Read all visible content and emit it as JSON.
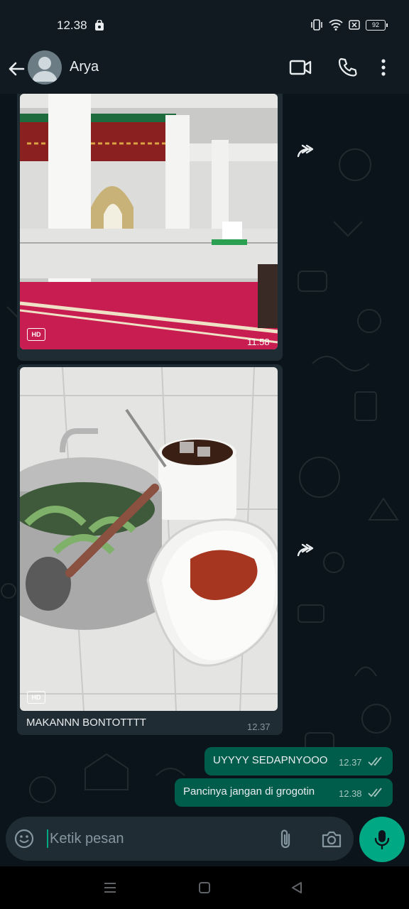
{
  "status_bar": {
    "time": "12.38",
    "battery": "92"
  },
  "header": {
    "contact_name": "Arya"
  },
  "messages": {
    "image1": {
      "time": "11.58",
      "hd_label": "HD"
    },
    "image2": {
      "time": "12.37",
      "hd_label": "HD",
      "caption": "MAKANNN BONTOTTTT"
    },
    "out1": {
      "text": "UYYYY SEDAPNYOOO",
      "time": "12.37"
    },
    "out2": {
      "text": "Pancinya jangan di grogotin",
      "time": "12.38"
    }
  },
  "input": {
    "placeholder": "Ketik pesan"
  },
  "colors": {
    "accent": "#00a884",
    "outgoing_bubble": "#005c4b",
    "incoming_bubble": "#202c33",
    "background": "#0b141a"
  },
  "icons": [
    "back-arrow-icon",
    "avatar-icon",
    "video-call-icon",
    "phone-icon",
    "more-icon",
    "forward-icon",
    "hd-icon",
    "double-check-icon",
    "emoji-icon",
    "attach-icon",
    "camera-icon",
    "mic-icon"
  ]
}
